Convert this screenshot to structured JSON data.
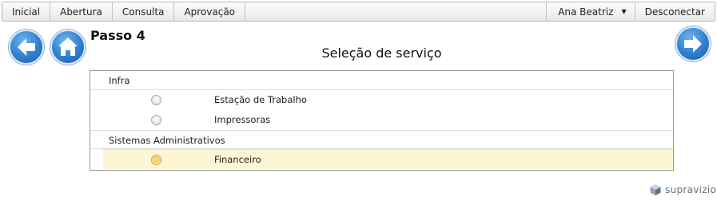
{
  "menu": {
    "items": [
      "Inicial",
      "Abertura",
      "Consulta",
      "Aprovação"
    ],
    "user": "Ana Beatriz",
    "logout": "Desconectar"
  },
  "icons": {
    "back": "arrow-left-icon",
    "home": "home-icon",
    "next": "arrow-right-icon",
    "user_menu": "caret-down-icon",
    "radio": "radio-button-icon",
    "logo": "supravizio-cube-icon"
  },
  "step": {
    "title": "Passo 4",
    "subtitle": "Seleção de serviço"
  },
  "groups": [
    {
      "label": "Infra",
      "options": [
        {
          "label": "Estação de Trabalho",
          "selected": false
        },
        {
          "label": "Impressoras",
          "selected": false
        }
      ]
    },
    {
      "label": "Sistemas Administrativos",
      "options": [
        {
          "label": "Financeiro",
          "selected": true
        }
      ]
    }
  ],
  "footer": {
    "logo_text": "supravizio"
  },
  "colors": {
    "accent_blue": "#2f7fd0",
    "selected_row": "#fcf6d4",
    "logo_gray": "#5f6f7e"
  }
}
